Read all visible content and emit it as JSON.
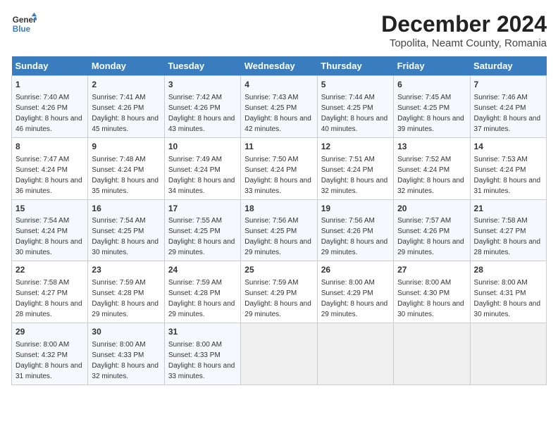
{
  "header": {
    "logo_line1": "General",
    "logo_line2": "Blue",
    "title": "December 2024",
    "subtitle": "Topolita, Neamt County, Romania"
  },
  "days_of_week": [
    "Sunday",
    "Monday",
    "Tuesday",
    "Wednesday",
    "Thursday",
    "Friday",
    "Saturday"
  ],
  "weeks": [
    [
      {
        "day": "1",
        "sunrise": "7:40 AM",
        "sunset": "4:26 PM",
        "daylight": "8 hours and 46 minutes."
      },
      {
        "day": "2",
        "sunrise": "7:41 AM",
        "sunset": "4:26 PM",
        "daylight": "8 hours and 45 minutes."
      },
      {
        "day": "3",
        "sunrise": "7:42 AM",
        "sunset": "4:26 PM",
        "daylight": "8 hours and 43 minutes."
      },
      {
        "day": "4",
        "sunrise": "7:43 AM",
        "sunset": "4:25 PM",
        "daylight": "8 hours and 42 minutes."
      },
      {
        "day": "5",
        "sunrise": "7:44 AM",
        "sunset": "4:25 PM",
        "daylight": "8 hours and 40 minutes."
      },
      {
        "day": "6",
        "sunrise": "7:45 AM",
        "sunset": "4:25 PM",
        "daylight": "8 hours and 39 minutes."
      },
      {
        "day": "7",
        "sunrise": "7:46 AM",
        "sunset": "4:24 PM",
        "daylight": "8 hours and 37 minutes."
      }
    ],
    [
      {
        "day": "8",
        "sunrise": "7:47 AM",
        "sunset": "4:24 PM",
        "daylight": "8 hours and 36 minutes."
      },
      {
        "day": "9",
        "sunrise": "7:48 AM",
        "sunset": "4:24 PM",
        "daylight": "8 hours and 35 minutes."
      },
      {
        "day": "10",
        "sunrise": "7:49 AM",
        "sunset": "4:24 PM",
        "daylight": "8 hours and 34 minutes."
      },
      {
        "day": "11",
        "sunrise": "7:50 AM",
        "sunset": "4:24 PM",
        "daylight": "8 hours and 33 minutes."
      },
      {
        "day": "12",
        "sunrise": "7:51 AM",
        "sunset": "4:24 PM",
        "daylight": "8 hours and 32 minutes."
      },
      {
        "day": "13",
        "sunrise": "7:52 AM",
        "sunset": "4:24 PM",
        "daylight": "8 hours and 32 minutes."
      },
      {
        "day": "14",
        "sunrise": "7:53 AM",
        "sunset": "4:24 PM",
        "daylight": "8 hours and 31 minutes."
      }
    ],
    [
      {
        "day": "15",
        "sunrise": "7:54 AM",
        "sunset": "4:24 PM",
        "daylight": "8 hours and 30 minutes."
      },
      {
        "day": "16",
        "sunrise": "7:54 AM",
        "sunset": "4:25 PM",
        "daylight": "8 hours and 30 minutes."
      },
      {
        "day": "17",
        "sunrise": "7:55 AM",
        "sunset": "4:25 PM",
        "daylight": "8 hours and 29 minutes."
      },
      {
        "day": "18",
        "sunrise": "7:56 AM",
        "sunset": "4:25 PM",
        "daylight": "8 hours and 29 minutes."
      },
      {
        "day": "19",
        "sunrise": "7:56 AM",
        "sunset": "4:26 PM",
        "daylight": "8 hours and 29 minutes."
      },
      {
        "day": "20",
        "sunrise": "7:57 AM",
        "sunset": "4:26 PM",
        "daylight": "8 hours and 29 minutes."
      },
      {
        "day": "21",
        "sunrise": "7:58 AM",
        "sunset": "4:27 PM",
        "daylight": "8 hours and 28 minutes."
      }
    ],
    [
      {
        "day": "22",
        "sunrise": "7:58 AM",
        "sunset": "4:27 PM",
        "daylight": "8 hours and 28 minutes."
      },
      {
        "day": "23",
        "sunrise": "7:59 AM",
        "sunset": "4:28 PM",
        "daylight": "8 hours and 29 minutes."
      },
      {
        "day": "24",
        "sunrise": "7:59 AM",
        "sunset": "4:28 PM",
        "daylight": "8 hours and 29 minutes."
      },
      {
        "day": "25",
        "sunrise": "7:59 AM",
        "sunset": "4:29 PM",
        "daylight": "8 hours and 29 minutes."
      },
      {
        "day": "26",
        "sunrise": "8:00 AM",
        "sunset": "4:29 PM",
        "daylight": "8 hours and 29 minutes."
      },
      {
        "day": "27",
        "sunrise": "8:00 AM",
        "sunset": "4:30 PM",
        "daylight": "8 hours and 30 minutes."
      },
      {
        "day": "28",
        "sunrise": "8:00 AM",
        "sunset": "4:31 PM",
        "daylight": "8 hours and 30 minutes."
      }
    ],
    [
      {
        "day": "29",
        "sunrise": "8:00 AM",
        "sunset": "4:32 PM",
        "daylight": "8 hours and 31 minutes."
      },
      {
        "day": "30",
        "sunrise": "8:00 AM",
        "sunset": "4:33 PM",
        "daylight": "8 hours and 32 minutes."
      },
      {
        "day": "31",
        "sunrise": "8:00 AM",
        "sunset": "4:33 PM",
        "daylight": "8 hours and 33 minutes."
      },
      null,
      null,
      null,
      null
    ]
  ],
  "labels": {
    "sunrise": "Sunrise:",
    "sunset": "Sunset:",
    "daylight": "Daylight:"
  }
}
